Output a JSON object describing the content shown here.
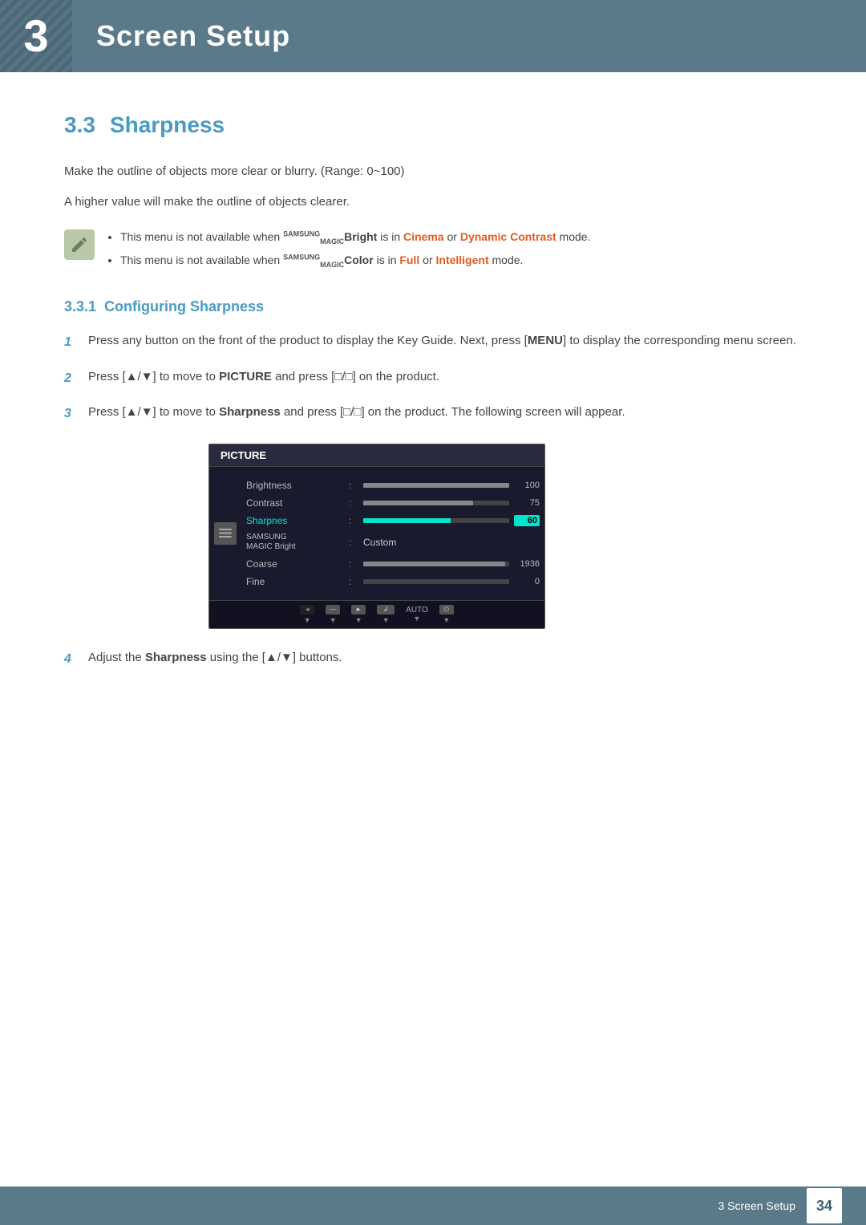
{
  "header": {
    "chapter_number": "3",
    "chapter_title": "Screen Setup"
  },
  "section": {
    "number": "3.3",
    "title": "Sharpness"
  },
  "intro_text_1": "Make the outline of objects more clear or blurry. (Range: 0~100)",
  "intro_text_2": "A higher value will make the outline of objects clearer.",
  "notes": [
    "This menu is not available when SAMSUNGBright is in Cinema or Dynamic Contrast mode.",
    "This menu is not available when SAMSUNGColor is in Full or Intelligent mode."
  ],
  "subsection": {
    "number": "3.3.1",
    "title": "Configuring Sharpness"
  },
  "steps": [
    {
      "num": "1",
      "text": "Press any button on the front of the product to display the Key Guide. Next, press [MENU] to display the corresponding menu screen."
    },
    {
      "num": "2",
      "text": "Press [▲/▼] to move to PICTURE and press [□/□] on the product."
    },
    {
      "num": "3",
      "text": "Press [▲/▼] to move to Sharpness and press [□/□] on the product. The following screen will appear."
    },
    {
      "num": "4",
      "text": "Adjust the Sharpness using the [▲/▼] buttons."
    }
  ],
  "osd": {
    "title": "PICTURE",
    "rows": [
      {
        "label": "Brightness",
        "type": "bar",
        "fill_pct": 100,
        "value": "100",
        "selected": false
      },
      {
        "label": "Contrast",
        "type": "bar",
        "fill_pct": 75,
        "value": "75",
        "selected": false
      },
      {
        "label": "Sharpnes",
        "type": "bar",
        "fill_pct": 60,
        "value": "60",
        "selected": true
      },
      {
        "label": "SAMSUNG MAGIC Bright",
        "type": "text",
        "text_value": "Custom",
        "selected": false
      },
      {
        "label": "Coarse",
        "type": "bar",
        "fill_pct": 97,
        "value": "1936",
        "selected": false
      },
      {
        "label": "Fine",
        "type": "bar",
        "fill_pct": 0,
        "value": "0",
        "selected": false
      }
    ]
  },
  "footer": {
    "section_label": "3 Screen Setup",
    "page_number": "34"
  }
}
